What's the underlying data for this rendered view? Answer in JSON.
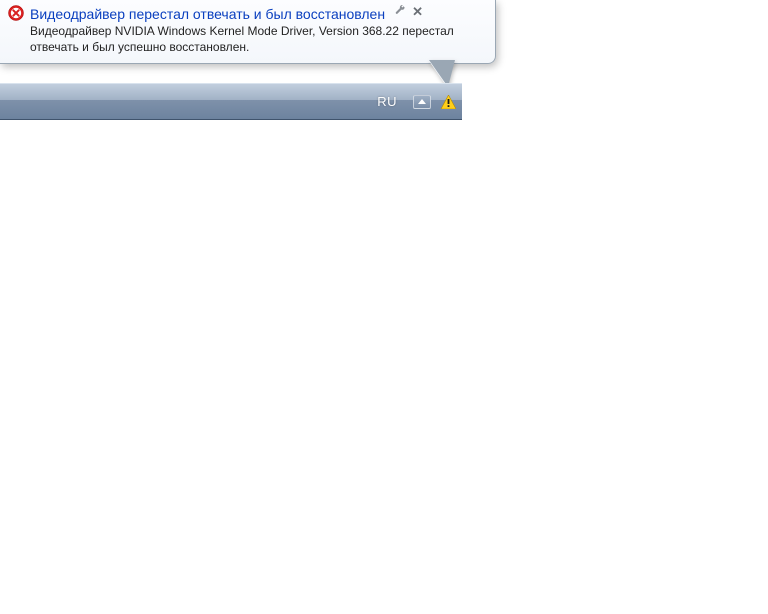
{
  "balloon": {
    "title": "Видеодрайвер перестал отвечать и был восстановлен",
    "body": "Видеодрайвер NVIDIA Windows Kernel Mode Driver, Version 368.22  перестал отвечать и был успешно восстановлен.",
    "icons": {
      "status": "error-icon",
      "settings": "No-break preferences",
      "close": "Close"
    }
  },
  "taskbar": {
    "language": "RU",
    "show_hidden_tooltip": "Show hidden icons",
    "tray_status": "warning"
  }
}
